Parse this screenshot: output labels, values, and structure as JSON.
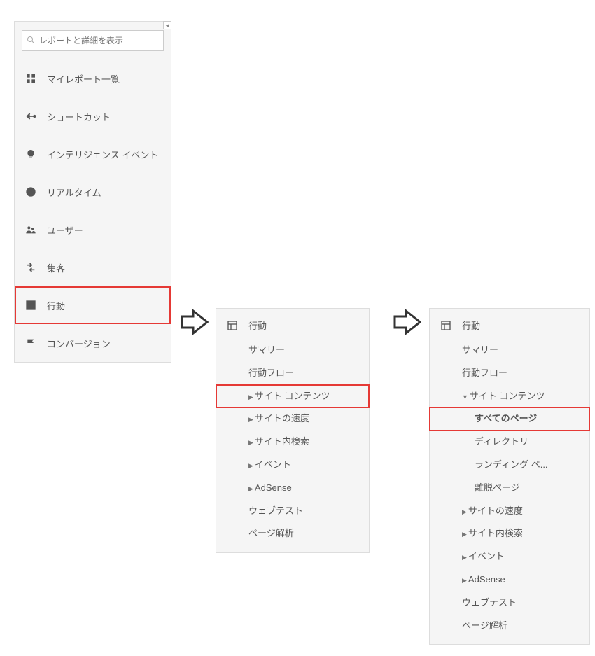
{
  "search": {
    "placeholder": "レポートと詳細を表示"
  },
  "nav": {
    "items": [
      {
        "label": "マイレポート一覧",
        "icon": "dashboard"
      },
      {
        "label": "ショートカット",
        "icon": "shortcut"
      },
      {
        "label": "インテリジェンス イベント",
        "icon": "bulb"
      },
      {
        "label": "リアルタイム",
        "icon": "clock"
      },
      {
        "label": "ユーザー",
        "icon": "users"
      },
      {
        "label": "集客",
        "icon": "acquisition"
      },
      {
        "label": "行動",
        "icon": "behavior",
        "highlighted": true
      },
      {
        "label": "コンバージョン",
        "icon": "flag"
      }
    ]
  },
  "panel2": {
    "head": "行動",
    "items": [
      {
        "label": "サマリー",
        "caret": false
      },
      {
        "label": "行動フロー",
        "caret": false
      },
      {
        "label": "サイト コンテンツ",
        "caret": true,
        "highlighted": true
      },
      {
        "label": "サイトの速度",
        "caret": true
      },
      {
        "label": "サイト内検索",
        "caret": true
      },
      {
        "label": "イベント",
        "caret": true
      },
      {
        "label": "AdSense",
        "caret": true
      },
      {
        "label": "ウェブテスト",
        "caret": false
      },
      {
        "label": "ページ解析",
        "caret": false
      }
    ]
  },
  "panel3": {
    "head": "行動",
    "items": [
      {
        "label": "サマリー",
        "type": "sub"
      },
      {
        "label": "行動フロー",
        "type": "sub"
      },
      {
        "label": "サイト コンテンツ",
        "type": "sub",
        "caret": "down"
      },
      {
        "label": "すべてのページ",
        "type": "subsub",
        "highlighted": true
      },
      {
        "label": "ディレクトリ",
        "type": "subsub"
      },
      {
        "label": "ランディング ペ...",
        "type": "subsub"
      },
      {
        "label": "離脱ページ",
        "type": "subsub"
      },
      {
        "label": "サイトの速度",
        "type": "sub",
        "caret": "right"
      },
      {
        "label": "サイト内検索",
        "type": "sub",
        "caret": "right"
      },
      {
        "label": "イベント",
        "type": "sub",
        "caret": "right"
      },
      {
        "label": "AdSense",
        "type": "sub",
        "caret": "right"
      },
      {
        "label": "ウェブテスト",
        "type": "sub"
      },
      {
        "label": "ページ解析",
        "type": "sub"
      }
    ]
  }
}
